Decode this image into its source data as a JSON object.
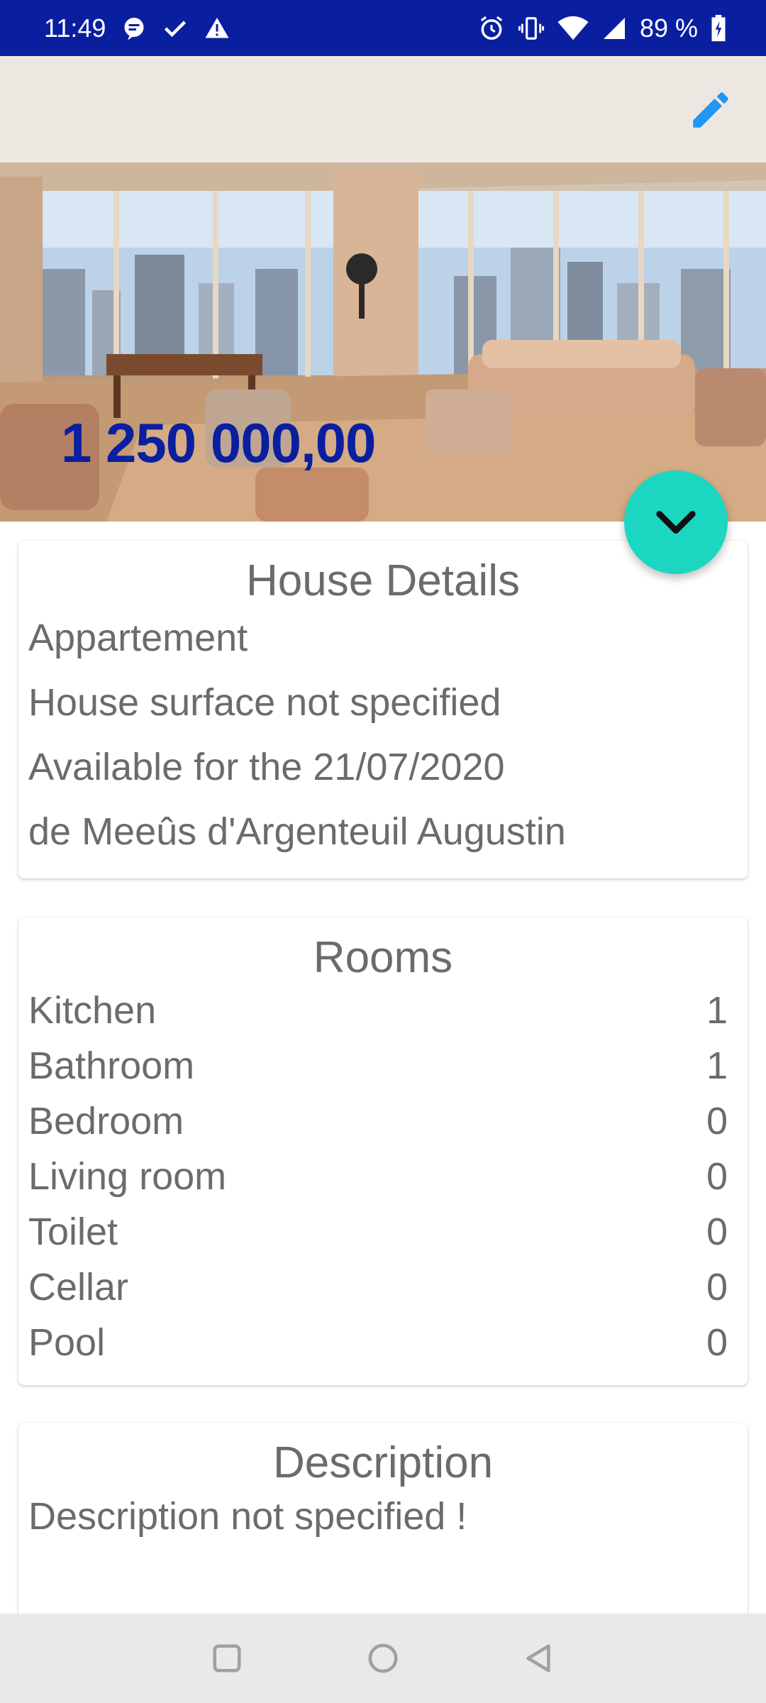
{
  "status_bar": {
    "time": "11:49",
    "battery": "89 %",
    "left_icons": [
      "message-icon",
      "check-icon",
      "warning-icon"
    ],
    "right_icons": [
      "alarm-icon",
      "vibrate-icon",
      "wifi-icon",
      "signal-icon",
      "battery-icon"
    ]
  },
  "hero": {
    "price": "1 250 000,00",
    "edit_icon": "pencil-icon",
    "fab_icon": "chevron-down-icon"
  },
  "house_details": {
    "title": "House Details",
    "type": "Appartement",
    "surface": "House surface not specified",
    "availability": "Available for the 21/07/2020",
    "owner": "de Meeûs d'Argenteuil Augustin"
  },
  "rooms": {
    "title": "Rooms",
    "items": [
      {
        "label": "Kitchen",
        "count": "1"
      },
      {
        "label": "Bathroom",
        "count": "1"
      },
      {
        "label": "Bedroom",
        "count": "0"
      },
      {
        "label": "Living room",
        "count": "0"
      },
      {
        "label": "Toilet",
        "count": "0"
      },
      {
        "label": "Cellar",
        "count": "0"
      },
      {
        "label": "Pool",
        "count": "0"
      }
    ]
  },
  "description": {
    "title": "Description",
    "text": "Description not specified !"
  },
  "nav_bar": {
    "buttons": [
      "recents-icon",
      "home-icon",
      "back-icon"
    ]
  },
  "colors": {
    "status_bar": "#0a1fa0",
    "price": "#0a1fa0",
    "fab": "#1bd7c2",
    "edit_icon": "#2196f3",
    "text": "#6b6b6b"
  }
}
